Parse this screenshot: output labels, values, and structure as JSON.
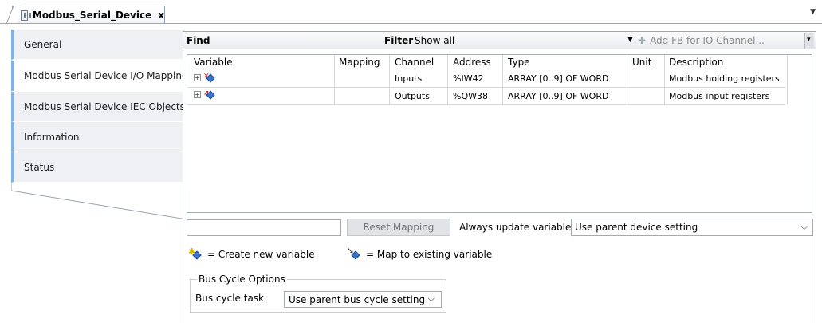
{
  "tab": {
    "title": "Modbus_Serial_Device",
    "close": "x"
  },
  "sidebar": {
    "items": [
      {
        "label": "General"
      },
      {
        "label": "Modbus Serial Device I/O Mapping"
      },
      {
        "label": "Modbus Serial Device IEC Objects"
      },
      {
        "label": "Information"
      },
      {
        "label": "Status"
      }
    ],
    "active_index": 1
  },
  "findbar": {
    "find_label": "Find",
    "filter_label": "Filter",
    "filter_value": "Show all",
    "add_fb_label": "Add FB for IO Channel..."
  },
  "table": {
    "headers": [
      "Variable",
      "Mapping",
      "Channel",
      "Address",
      "Type",
      "Unit",
      "Description"
    ],
    "rows": [
      {
        "variable": "",
        "mapping": "",
        "channel": "Inputs",
        "address": "%IW42",
        "type": "ARRAY [0..9] OF WORD",
        "unit": "",
        "description": "Modbus holding registers"
      },
      {
        "variable": "",
        "mapping": "",
        "channel": "Outputs",
        "address": "%QW38",
        "type": "ARRAY [0..9] OF WORD",
        "unit": "",
        "description": "Modbus input registers"
      }
    ]
  },
  "controls": {
    "reset_mapping_label": "Reset Mapping",
    "always_update_label": "Always update variables",
    "update_setting_value": "Use parent device setting"
  },
  "legend": {
    "create_new": "= Create new variable",
    "map_existing": "= Map to existing variable"
  },
  "bus_cycle": {
    "group_title": "Bus Cycle Options",
    "task_label": "Bus cycle task",
    "task_value": "Use parent bus cycle setting"
  },
  "colors": {
    "accent": "#7eb4e3",
    "variable_icon": "#3b74c5"
  },
  "icons": {
    "tab_icon": "device-icon",
    "expand": "plus-expander-icon",
    "input_var": "input-variable-icon",
    "output_var": "output-variable-icon"
  }
}
